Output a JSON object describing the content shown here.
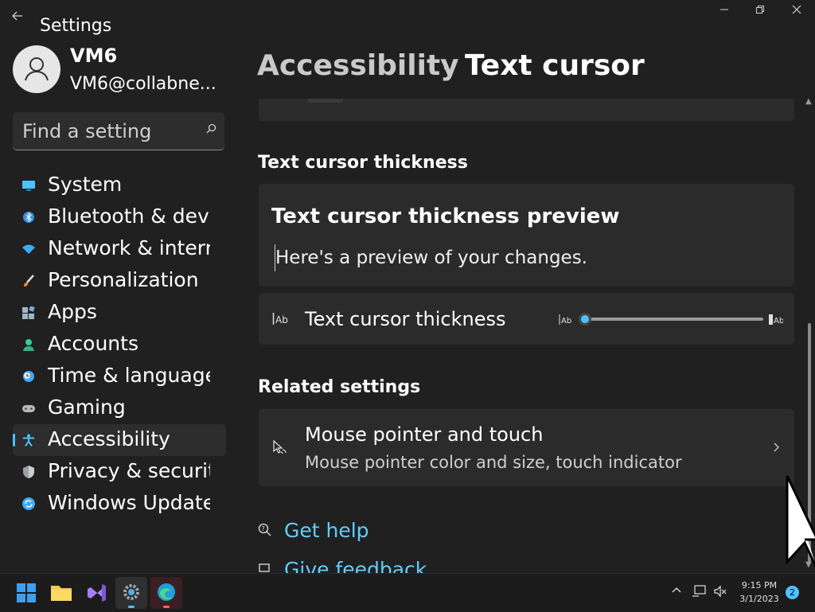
{
  "window": {
    "title": "Settings",
    "minimize_icon": "minimize-icon",
    "maximize_icon": "restore-icon",
    "close_icon": "close-icon"
  },
  "user": {
    "name": "VM6",
    "email": "VM6@collabne..."
  },
  "search": {
    "placeholder": "Find a setting"
  },
  "nav": {
    "items": [
      {
        "label": "System",
        "icon": "monitor-icon"
      },
      {
        "label": "Bluetooth & devi",
        "icon": "bluetooth-icon"
      },
      {
        "label": "Network & interr",
        "icon": "wifi-icon"
      },
      {
        "label": "Personalization",
        "icon": "brush-icon"
      },
      {
        "label": "Apps",
        "icon": "apps-icon"
      },
      {
        "label": "Accounts",
        "icon": "person-icon"
      },
      {
        "label": "Time & language",
        "icon": "clock-globe-icon"
      },
      {
        "label": "Gaming",
        "icon": "gamepad-icon"
      },
      {
        "label": "Accessibility",
        "icon": "accessibility-icon",
        "selected": true
      },
      {
        "label": "Privacy & securit",
        "icon": "shield-icon"
      },
      {
        "label": "Windows Update",
        "icon": "update-icon"
      }
    ]
  },
  "breadcrumb": {
    "parent": "Accessibility",
    "separator": "›",
    "current": "Text cursor"
  },
  "thickness": {
    "section_title": "Text cursor thickness",
    "preview_title": "Text cursor thickness preview",
    "preview_text": "Here's a preview of your changes.",
    "setting_label": "Text cursor thickness",
    "slider_min_icon": "thin-cursor-icon",
    "slider_max_icon": "thick-cursor-icon",
    "slider_level": 0
  },
  "related": {
    "section_title": "Related settings",
    "item_title": "Mouse pointer and touch",
    "item_desc": "Mouse pointer color and size, touch indicator"
  },
  "help": {
    "get_help": "Get help",
    "give_feedback": "Give feedback"
  },
  "taskbar": {
    "apps": [
      "start-icon",
      "file-explorer-icon",
      "visual-studio-icon",
      "settings-icon",
      "edge-icon"
    ],
    "time": "9:15 PM",
    "date": "3/1/2023",
    "notification_count": "2"
  },
  "colors": {
    "accent": "#4cc2ff",
    "link": "#60cdff",
    "background": "#202020",
    "card": "#2b2b2b"
  }
}
